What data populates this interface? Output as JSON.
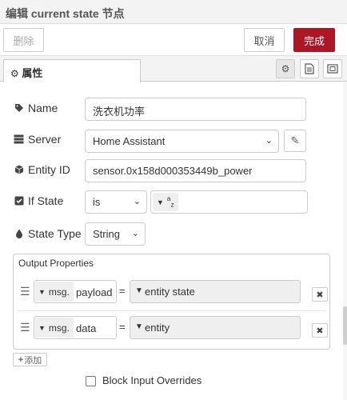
{
  "dialog": {
    "title": "编辑 current state 节点"
  },
  "buttons": {
    "delete": "删除",
    "cancel": "取消",
    "done": "完成"
  },
  "tabs": {
    "properties": "属性"
  },
  "icons": {
    "tab": "gear-icon",
    "settings": "gear-icon",
    "description": "document-icon",
    "appearance": "frame-icon",
    "name": "tag-icon",
    "server": "server-icon",
    "entity": "cube-icon",
    "if_state": "checkbox-icon",
    "state_type": "drop-icon",
    "edit": "pencil-icon"
  },
  "form": {
    "name_label": "Name",
    "name_value": "洗衣机功率",
    "server_label": "Server",
    "server_value": "Home Assistant",
    "entity_label": "Entity ID",
    "entity_value": "sensor.0x158d000353449b_power",
    "if_state_label": "If State",
    "if_state_op": "is",
    "if_state_type_glyph": "a z",
    "state_type_label": "State Type",
    "state_type_value": "String"
  },
  "output": {
    "title": "Output Properties",
    "rows": [
      {
        "prefix": "msg.",
        "property": "payload",
        "equals": "=",
        "value": "entity state"
      },
      {
        "prefix": "msg.",
        "property": "data",
        "equals": "=",
        "value": "entity"
      }
    ],
    "add_label": "添加"
  },
  "block_input": {
    "label": "Block Input Overrides",
    "checked": false
  },
  "colors": {
    "accent": "#ad1625"
  }
}
